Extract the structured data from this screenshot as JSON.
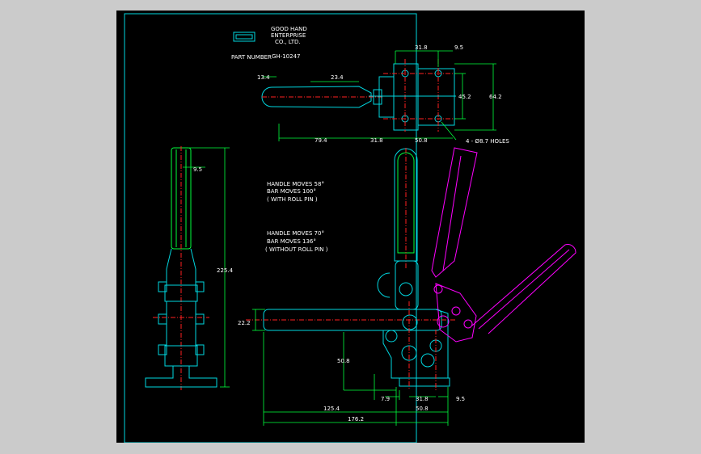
{
  "title_block": {
    "company_line1": "GOOD HAND",
    "company_line2": "ENTERPRISE",
    "company_line3": "CO., LTD.",
    "part_number_label": "PART NUMBER",
    "part_number": "GH-10247"
  },
  "notes": {
    "with_roll_pin": [
      "HANDLE MOVES 58°",
      "BAR     MOVES 100°",
      "( WITH ROLL PIN )"
    ],
    "without_roll_pin": [
      "HANDLE MOVES 70°",
      "BAR     MOVES 136°",
      "( WITHOUT ROLL PIN )"
    ]
  },
  "dimensions": {
    "top_view": {
      "d13_4": "13.4",
      "d23_4": "23.4",
      "d79_4": "79.4",
      "d31_8_bottom": "31.8",
      "d50_8": "50.8",
      "d31_8_top": "31.8",
      "d9_5": "9.5",
      "d45_2": "45.2",
      "d64_2": "64.2",
      "holes": "4 - Ø8.7 HOLES"
    },
    "side_view": {
      "d9_5": "9.5",
      "d225_4": "225.4"
    },
    "front_view": {
      "d22_2": "22.2",
      "d50_8_vert": "50.8",
      "d7_9": "7.9",
      "d31_8": "31.8",
      "d9_5": "9.5",
      "d125_4": "125.4",
      "d50_8": "50.8",
      "d176_2": "176.2"
    }
  },
  "colors": {
    "background": "#000000",
    "frame": "#cbcbcb",
    "outline": "#00d7e0",
    "dimension": "#00ff3c",
    "alt_position": "#ff00ff",
    "centerline": "#ff2020",
    "text": "#ffffff"
  }
}
